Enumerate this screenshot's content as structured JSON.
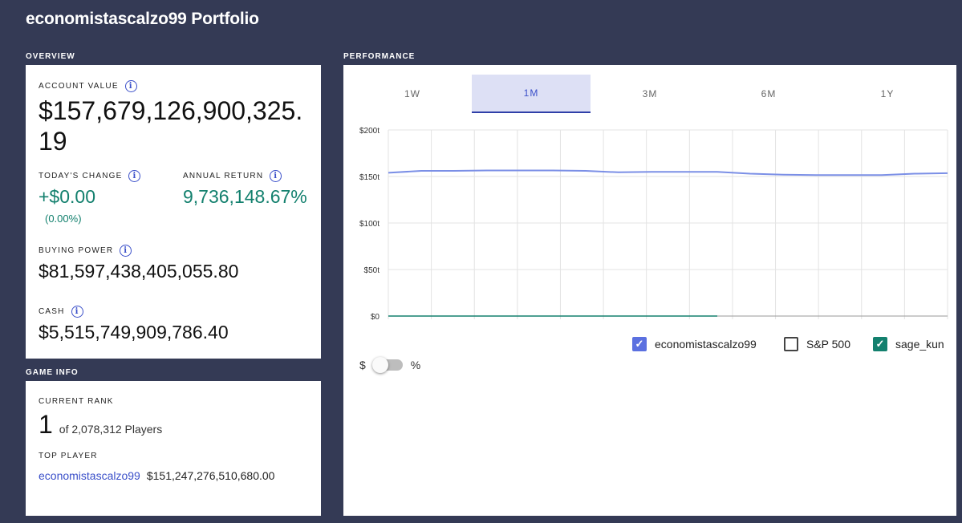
{
  "title": "economistascalzo99 Portfolio",
  "overview": {
    "section_label": "OVERVIEW",
    "account_value_label": "ACCOUNT VALUE",
    "account_value": "$157,679,126,900,325.19",
    "todays_change_label": "TODAY'S CHANGE",
    "todays_change": "+$0.00",
    "todays_change_pct": "(0.00%)",
    "annual_return_label": "ANNUAL RETURN",
    "annual_return": "9,736,148.67%",
    "buying_power_label": "BUYING POWER",
    "buying_power": "$81,597,438,405,055.80",
    "cash_label": "CASH",
    "cash": "$5,515,749,909,786.40"
  },
  "game_info": {
    "section_label": "GAME INFO",
    "current_rank_label": "CURRENT RANK",
    "rank": "1",
    "rank_suffix": "of 2,078,312 Players",
    "top_player_label": "TOP PLAYER",
    "top_player_name": "economistascalzo99",
    "top_player_value": "$151,247,276,510,680.00"
  },
  "performance": {
    "section_label": "PERFORMANCE",
    "tabs": [
      {
        "label": "1W",
        "active": false
      },
      {
        "label": "1M",
        "active": true
      },
      {
        "label": "3M",
        "active": false
      },
      {
        "label": "6M",
        "active": false
      },
      {
        "label": "1Y",
        "active": false
      }
    ],
    "legend": [
      {
        "label": "economistascalzo99",
        "checked": true,
        "color": "#5b70e0"
      },
      {
        "label": "S&P 500",
        "checked": false,
        "color": "#444444"
      },
      {
        "label": "sage_kun",
        "checked": true,
        "color": "#13806e"
      }
    ],
    "toggle": {
      "left_label": "$",
      "right_label": "%",
      "state": "$"
    }
  },
  "chart_data": {
    "type": "line",
    "ylim": [
      0,
      200
    ],
    "y_unit": "t",
    "yticks": [
      "$200t",
      "$150t",
      "$100t",
      "$50t",
      "$0"
    ],
    "ytick_values": [
      200,
      150,
      100,
      50,
      0
    ],
    "grid": true,
    "n_points": 14,
    "series": [
      {
        "name": "economistascalzo99",
        "color": "#7b8fe6",
        "values": [
          154,
          156,
          156,
          156.5,
          156.5,
          156.5,
          156,
          154.5,
          155,
          155,
          155,
          153,
          152,
          151.5,
          151.5,
          151.5,
          153,
          153.5
        ]
      },
      {
        "name": "sage_kun",
        "color": "#13806e",
        "values": [
          0,
          0,
          0,
          0,
          0,
          0,
          0,
          0,
          0,
          0,
          0
        ]
      }
    ]
  }
}
